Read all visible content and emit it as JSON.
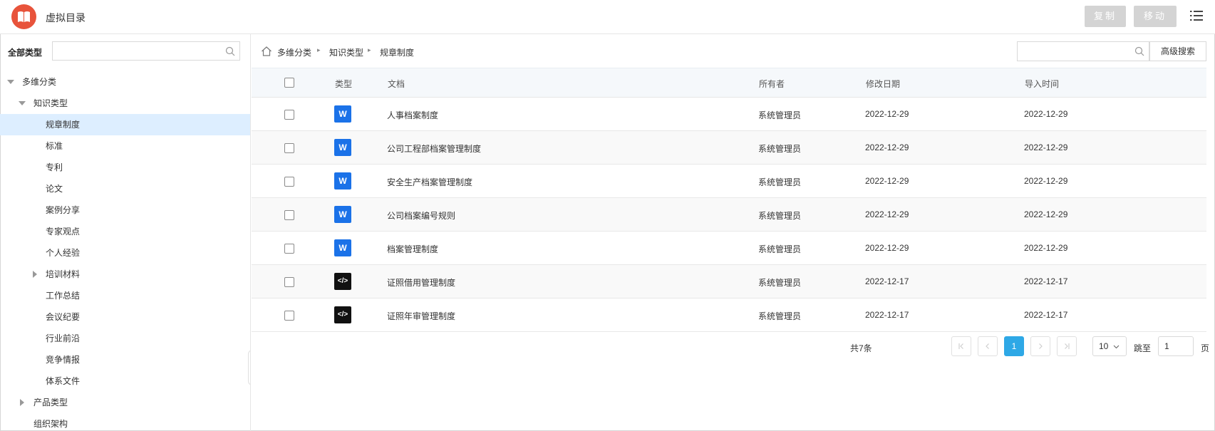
{
  "app": {
    "title": "虚拟目录"
  },
  "toolbar": {
    "copy_label": "复制",
    "move_label": "移动",
    "menu_icon": "list-menu-icon"
  },
  "sidebar": {
    "header": "全部类型",
    "search": {
      "placeholder": "",
      "value": ""
    },
    "tree": [
      {
        "label": "多维分类",
        "level": 0,
        "expander": "expanded"
      },
      {
        "label": "知识类型",
        "level": 1,
        "expander": "expanded"
      },
      {
        "label": "规章制度",
        "level": 2,
        "expander": "none",
        "selected": true
      },
      {
        "label": "标准",
        "level": 2,
        "expander": "none"
      },
      {
        "label": "专利",
        "level": 2,
        "expander": "none"
      },
      {
        "label": "论文",
        "level": 2,
        "expander": "none"
      },
      {
        "label": "案例分享",
        "level": 2,
        "expander": "none"
      },
      {
        "label": "专家观点",
        "level": 2,
        "expander": "none"
      },
      {
        "label": "个人经验",
        "level": 2,
        "expander": "none"
      },
      {
        "label": "培训材料",
        "level": 2,
        "expander": "collapsed"
      },
      {
        "label": "工作总结",
        "level": 2,
        "expander": "none"
      },
      {
        "label": "会议纪要",
        "level": 2,
        "expander": "none"
      },
      {
        "label": "行业前沿",
        "level": 2,
        "expander": "none"
      },
      {
        "label": "竞争情报",
        "level": 2,
        "expander": "none"
      },
      {
        "label": "体系文件",
        "level": 2,
        "expander": "none"
      },
      {
        "label": "产品类型",
        "level": 1,
        "expander": "collapsed"
      },
      {
        "label": "组织架构",
        "level": 1,
        "expander": "none"
      }
    ]
  },
  "breadcrumb": [
    "多维分类",
    "知识类型",
    "规章制度"
  ],
  "search": {
    "placeholder": "",
    "value": "",
    "advanced_label": "高级搜索"
  },
  "table": {
    "columns": {
      "type": "类型",
      "doc": "文档",
      "owner": "所有者",
      "modified": "修改日期",
      "imported": "导入时间"
    },
    "rows": [
      {
        "icon": "word-doc-icon",
        "icon_text": "W",
        "name": "人事档案制度",
        "owner": "系统管理员",
        "modified": "2022-12-29",
        "imported": "2022-12-29"
      },
      {
        "icon": "word-doc-icon",
        "icon_text": "W",
        "name": "公司工程部档案管理制度",
        "owner": "系统管理员",
        "modified": "2022-12-29",
        "imported": "2022-12-29"
      },
      {
        "icon": "word-doc-icon",
        "icon_text": "W",
        "name": "安全生产档案管理制度",
        "owner": "系统管理员",
        "modified": "2022-12-29",
        "imported": "2022-12-29"
      },
      {
        "icon": "word-doc-icon",
        "icon_text": "W",
        "name": "公司档案编号规则",
        "owner": "系统管理员",
        "modified": "2022-12-29",
        "imported": "2022-12-29"
      },
      {
        "icon": "word-doc-icon",
        "icon_text": "W",
        "name": "档案管理制度",
        "owner": "系统管理员",
        "modified": "2022-12-29",
        "imported": "2022-12-29"
      },
      {
        "icon": "code-file-icon",
        "icon_text": "</>",
        "name": "证照借用管理制度",
        "owner": "系统管理员",
        "modified": "2022-12-17",
        "imported": "2022-12-17"
      },
      {
        "icon": "code-file-icon",
        "icon_text": "</>",
        "name": "证照年审管理制度",
        "owner": "系统管理员",
        "modified": "2022-12-17",
        "imported": "2022-12-17"
      }
    ]
  },
  "pagination": {
    "total_text": "共7条",
    "current_page": "1",
    "page_size": "10",
    "jump_label": "跳至",
    "jump_value": "1",
    "page_suffix": "页"
  },
  "colors": {
    "accent": "#2ea8e6",
    "logo": "#e8533b",
    "word_icon": "#1b72e8",
    "selected_row": "#ddeeff",
    "disabled_button": "#d4d4d4"
  }
}
